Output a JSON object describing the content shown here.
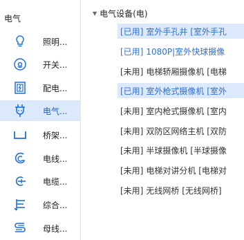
{
  "sidebar": {
    "title": "电气",
    "items": [
      {
        "label": "照明...",
        "icon": "lightbulb-icon",
        "active": false
      },
      {
        "label": "开关...",
        "icon": "switch-icon",
        "active": false
      },
      {
        "label": "配电...",
        "icon": "distribution-box-icon",
        "active": false
      },
      {
        "label": "电气...",
        "icon": "plug-icon",
        "active": true
      },
      {
        "label": "桥架...",
        "icon": "cable-tray-icon",
        "active": false
      },
      {
        "label": "电线...",
        "icon": "wire-icon",
        "active": false
      },
      {
        "label": "电缆...",
        "icon": "cable-icon",
        "active": false
      },
      {
        "label": "综合...",
        "icon": "integrated-icon",
        "active": false
      },
      {
        "label": "母线...",
        "icon": "busbar-icon",
        "active": false
      }
    ]
  },
  "tree": {
    "root_label": "电气设备(电)",
    "rows": [
      {
        "status": "[已用]",
        "text": "室外手孔井 [室外手孔",
        "used": true,
        "selected": true
      },
      {
        "status": "[已用]",
        "text": "1080P|室外快球摄像",
        "used": true,
        "selected": false
      },
      {
        "status": "[未用]",
        "text": "电梯轿厢摄像机 [电梯",
        "used": false,
        "selected": false
      },
      {
        "status": "[已用]",
        "text": "室外枪式摄像机 [室外",
        "used": true,
        "selected": true
      },
      {
        "status": "[未用]",
        "text": "室内枪式摄像机 [室内",
        "used": false,
        "selected": false
      },
      {
        "status": "[未用]",
        "text": "双防区网络主机 [双防",
        "used": false,
        "selected": false
      },
      {
        "status": "[未用]",
        "text": "半球摄像机 [半球摄像",
        "used": false,
        "selected": false
      },
      {
        "status": "[未用]",
        "text": "电梯对讲分机 [电梯对",
        "used": false,
        "selected": false
      },
      {
        "status": "[未用]",
        "text": "无线网桥 [无线网桥]",
        "used": false,
        "selected": false
      }
    ]
  },
  "colors": {
    "accent": "#2f6fd6",
    "selection": "#dbe9fb"
  }
}
